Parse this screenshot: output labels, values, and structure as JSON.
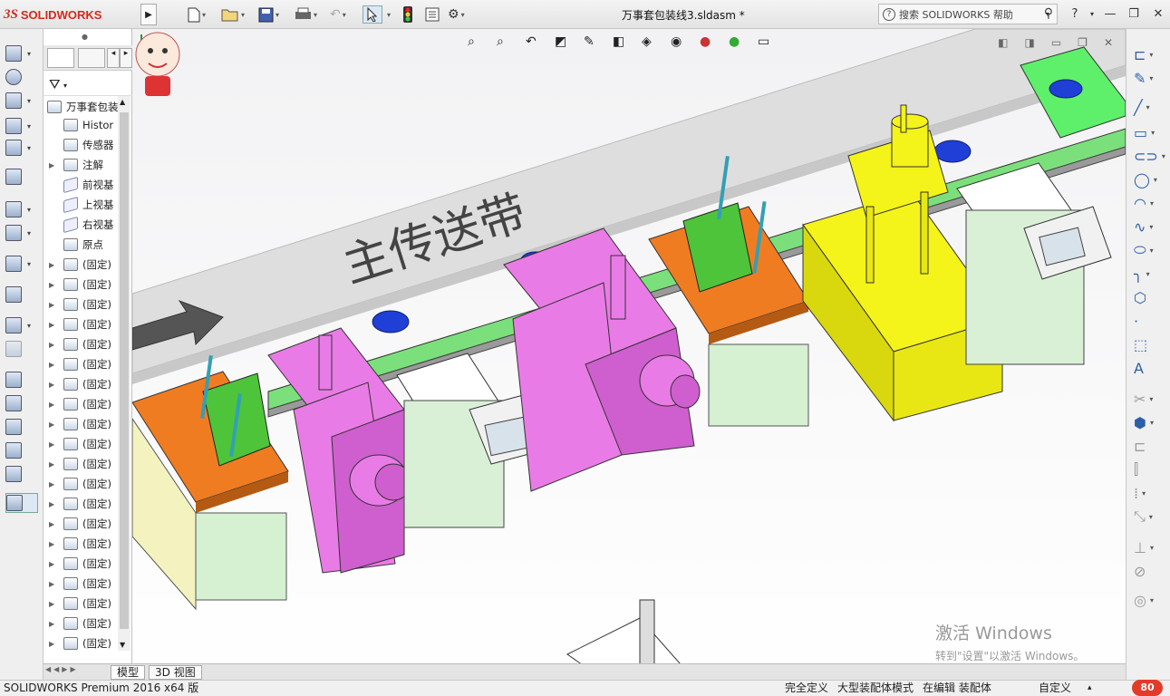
{
  "app": {
    "logo_prefix": "3S",
    "logo_name": "SOLIDWORKS",
    "doc_title": "万事套包装线3.sldasm *"
  },
  "help_search": {
    "label": "搜索 SOLIDWORKS 帮助"
  },
  "toolbar": {
    "items": [
      "new-document",
      "open",
      "save",
      "print",
      "undo",
      "select",
      "rebuild",
      "file-properties",
      "options"
    ]
  },
  "tree": {
    "root": "万事套包装",
    "items": [
      {
        "label": "Histor",
        "icon": "history-icon"
      },
      {
        "label": "传感器",
        "icon": "sensor-icon"
      },
      {
        "label": "注解",
        "icon": "annotation-icon"
      },
      {
        "label": "前视基",
        "icon": "plane-icon"
      },
      {
        "label": "上视基",
        "icon": "plane-icon"
      },
      {
        "label": "右视基",
        "icon": "plane-icon"
      },
      {
        "label": "原点",
        "icon": "origin-icon"
      }
    ],
    "component_label": "(固定)",
    "component_count": 20
  },
  "scene": {
    "belt_label": "主传送带"
  },
  "watermark": {
    "line1": "激活 Windows",
    "line2": "转到\"设置\"以激活 Windows。"
  },
  "tabs": {
    "model": "模型",
    "view3d": "3D 视图"
  },
  "status": {
    "product": "SOLIDWORKS Premium 2016 x64 版",
    "defined": "完全定义",
    "mode": "大型装配体模式",
    "editing": "在编辑 装配体",
    "custom": "自定义",
    "badge": "80"
  },
  "colors": {
    "orange": "#f07c22",
    "pink": "#e97be6",
    "yellow": "#f4f31a",
    "green": "#5ef06b",
    "blue": "#1f3fd6",
    "belt": "#dcdcdc"
  }
}
